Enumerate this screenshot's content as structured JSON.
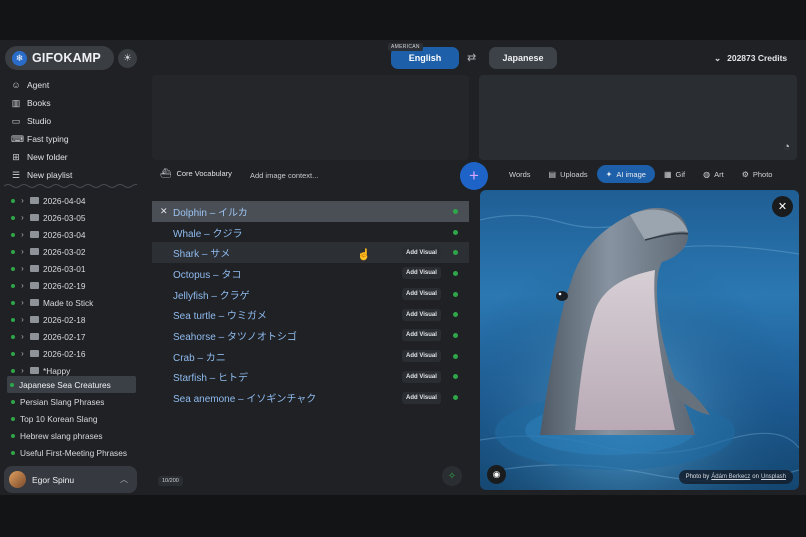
{
  "brand": {
    "name": "GIFOKAMP"
  },
  "nav": [
    {
      "label": "Agent",
      "icon": "robot-icon"
    },
    {
      "label": "Books",
      "icon": "books-icon"
    },
    {
      "label": "Studio",
      "icon": "film-icon"
    },
    {
      "label": "Fast typing",
      "icon": "keyboard-icon"
    },
    {
      "label": "New folder",
      "icon": "folder-plus-icon"
    },
    {
      "label": "New playlist",
      "icon": "playlist-icon"
    }
  ],
  "folders": [
    "2026-04-04",
    "2026-03-05",
    "2026-03-04",
    "2026-03-02",
    "2026-03-01",
    "2026-02-19",
    "Made to Stick",
    "2026-02-18",
    "2026-02-17",
    "2026-02-16",
    "*Happy"
  ],
  "playlists": [
    "Japanese Sea Creatures",
    "Persian Slang Phrases",
    "Top 10 Korean Slang",
    "Hebrew slang phrases",
    "Useful First-Meeting Phrases"
  ],
  "user": {
    "name": "Egor Spinu"
  },
  "languages": {
    "source_variant": "AMERICAN",
    "source": "English",
    "target": "Japanese"
  },
  "credits": "202873 Credits",
  "toolbar": {
    "core_label": "Core Vocabulary",
    "context_placeholder": "Add image context...",
    "tabs": [
      {
        "label": "Words",
        "icon": ""
      },
      {
        "label": "Uploads",
        "icon": "▤"
      },
      {
        "label": "AI image",
        "icon": "✦"
      },
      {
        "label": "Gif",
        "icon": "▦"
      },
      {
        "label": "Art",
        "icon": "◍"
      },
      {
        "label": "Photo",
        "icon": "⚙"
      }
    ]
  },
  "words": [
    {
      "text": "Dolphin – イルカ",
      "add_visual": ""
    },
    {
      "text": "Whale – クジラ",
      "add_visual": ""
    },
    {
      "text": "Shark – サメ",
      "add_visual": "Add Visual"
    },
    {
      "text": "Octopus – タコ",
      "add_visual": "Add Visual"
    },
    {
      "text": "Jellyfish – クラゲ",
      "add_visual": "Add Visual"
    },
    {
      "text": "Sea turtle – ウミガメ",
      "add_visual": "Add Visual"
    },
    {
      "text": "Seahorse – タツノオトシゴ",
      "add_visual": "Add Visual"
    },
    {
      "text": "Crab – カニ",
      "add_visual": "Add Visual"
    },
    {
      "text": "Starfish – ヒトデ",
      "add_visual": "Add Visual"
    },
    {
      "text": "Sea anemone – イソギンチャク",
      "add_visual": "Add Visual"
    }
  ],
  "counter": "10/200",
  "photo_credit": {
    "prefix": "Photo by",
    "author": "Ádám Berkecz",
    "on": "on",
    "source": "Unsplash"
  },
  "colors": {
    "accent": "#1d5fa8",
    "plus": "#1e64c8",
    "status": "#2fa64a",
    "link": "#8fbbef"
  }
}
